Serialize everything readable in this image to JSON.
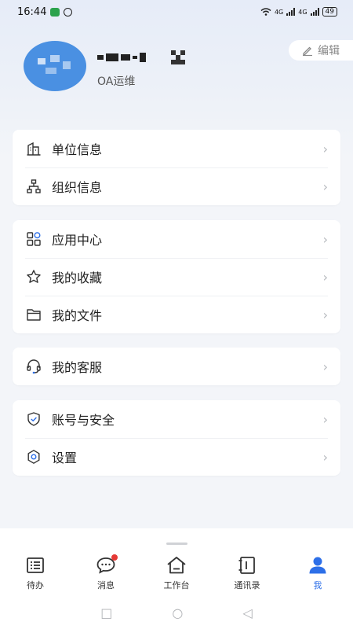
{
  "status": {
    "time": "16:44",
    "battery": "49",
    "net1": "4G",
    "net2": "4G"
  },
  "profile": {
    "role": "OA运维",
    "edit_label": "编辑"
  },
  "groups": [
    {
      "items": [
        {
          "label": "单位信息",
          "icon": "building-icon"
        },
        {
          "label": "组织信息",
          "icon": "org-chart-icon"
        }
      ]
    },
    {
      "items": [
        {
          "label": "应用中心",
          "icon": "apps-grid-icon"
        },
        {
          "label": "我的收藏",
          "icon": "star-icon"
        },
        {
          "label": "我的文件",
          "icon": "folder-icon"
        }
      ]
    },
    {
      "items": [
        {
          "label": "我的客服",
          "icon": "headset-icon"
        }
      ]
    },
    {
      "items": [
        {
          "label": "账号与安全",
          "icon": "shield-icon"
        },
        {
          "label": "设置",
          "icon": "gear-icon"
        }
      ]
    }
  ],
  "tabbar": [
    {
      "label": "待办",
      "icon": "todo-list-icon"
    },
    {
      "label": "消息",
      "icon": "chat-bubble-icon"
    },
    {
      "label": "工作台",
      "icon": "home-icon"
    },
    {
      "label": "通讯录",
      "icon": "contacts-book-icon"
    },
    {
      "label": "我",
      "icon": "person-icon",
      "active": true
    }
  ],
  "colors": {
    "accent": "#2d6fe8",
    "avatar": "#4a90e2",
    "badge": "#e53935"
  }
}
